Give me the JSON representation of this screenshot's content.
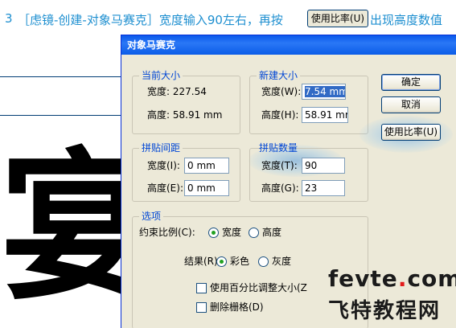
{
  "header": {
    "step": "3",
    "text_before": "［虑镜-创建-对象马赛克］宽度输入90左右，再按",
    "button_label": "使用比率(U)",
    "text_after": "出现高度数值"
  },
  "background_art": {
    "glyph": "宴"
  },
  "dialog": {
    "title": "对象马赛克",
    "current_size": {
      "title": "当前大小",
      "width_label": "宽度: 227.54",
      "height_label": "高度: 58.91 mm"
    },
    "new_size": {
      "title": "新建大小",
      "width_label": "宽度(W):",
      "width_value": "7.54 mm",
      "height_label": "高度(H):",
      "height_value": "58.91 mr"
    },
    "tile_spacing": {
      "title": "拼贴间距",
      "width_label": "宽度(I):",
      "width_value": "0 mm",
      "height_label": "高度(E):",
      "height_value": "0 mm"
    },
    "tile_count": {
      "title": "拼贴数量",
      "width_label": "宽度(T):",
      "width_value": "90",
      "height_label": "高度(G):",
      "height_value": "23"
    },
    "options": {
      "title": "选项",
      "constrain_label": "约束比例(C):",
      "constrain_choices": [
        "宽度",
        "高度"
      ],
      "constrain_selected": "宽度",
      "result_label": "结果(R):",
      "result_choices": [
        "彩色",
        "灰度"
      ],
      "result_selected": "彩色",
      "resize_by_percent": "使用百分比调整大小(Z",
      "delete_raster": "删除栅格(D)"
    },
    "buttons": {
      "ok": "确定",
      "cancel": "取消",
      "use_ratio": "使用比率(U)"
    }
  },
  "watermark": {
    "line1": "fevte",
    "line1_dot": ".",
    "line1_tld": "com",
    "line2": "飞特教程网"
  }
}
